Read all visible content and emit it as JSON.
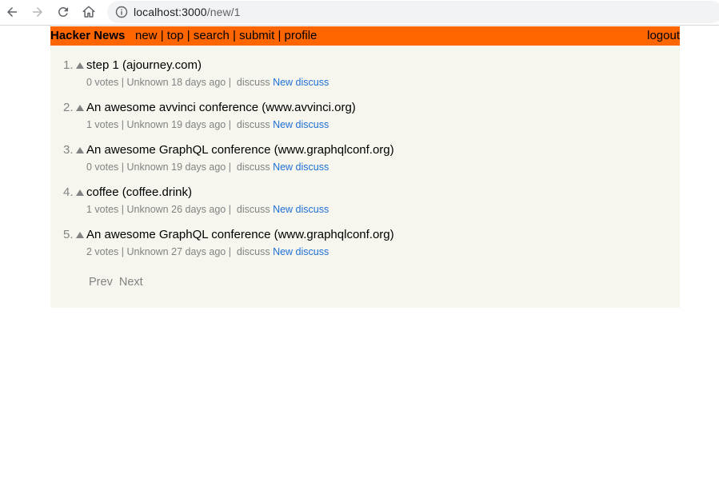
{
  "browser": {
    "url_host": "localhost:3000",
    "url_path": "/new/1"
  },
  "header": {
    "brand": "Hacker News",
    "links": [
      "new",
      "top",
      "search",
      "submit",
      "profile"
    ],
    "separator": " | ",
    "logout": "logout"
  },
  "items": [
    {
      "rank": "1.",
      "title": "step 1 (ajourney.com)",
      "votes": "0 votes",
      "by": "Unknown",
      "age": "18 days ago",
      "discuss": "discuss",
      "new_discuss": "New discuss"
    },
    {
      "rank": "2.",
      "title": "An awesome avvinci conference (www.avvinci.org)",
      "votes": "1 votes",
      "by": "Unknown",
      "age": "19 days ago",
      "discuss": "discuss",
      "new_discuss": "New discuss"
    },
    {
      "rank": "3.",
      "title": "An awesome GraphQL conference (www.graphqlconf.org)",
      "votes": "0 votes",
      "by": "Unknown",
      "age": "19 days ago",
      "discuss": "discuss",
      "new_discuss": "New discuss"
    },
    {
      "rank": "4.",
      "title": "coffee (coffee.drink)",
      "votes": "1 votes",
      "by": "Unknown",
      "age": "26 days ago",
      "discuss": "discuss",
      "new_discuss": "New discuss"
    },
    {
      "rank": "5.",
      "title": "An awesome GraphQL conference (www.graphqlconf.org)",
      "votes": "2 votes",
      "by": "Unknown",
      "age": "27 days ago",
      "discuss": "discuss",
      "new_discuss": "New discuss"
    }
  ],
  "pager": {
    "prev": "Prev",
    "next": "Next"
  },
  "colors": {
    "header": "#ff6600",
    "page_bg": "#f6f6ef",
    "muted": "#828282",
    "link": "#1f6fd6"
  },
  "icons": {
    "back": "arrow-left-icon",
    "forward": "arrow-right-icon",
    "reload": "reload-icon",
    "home": "home-icon",
    "info": "info-icon",
    "vote": "upvote-triangle-icon"
  }
}
